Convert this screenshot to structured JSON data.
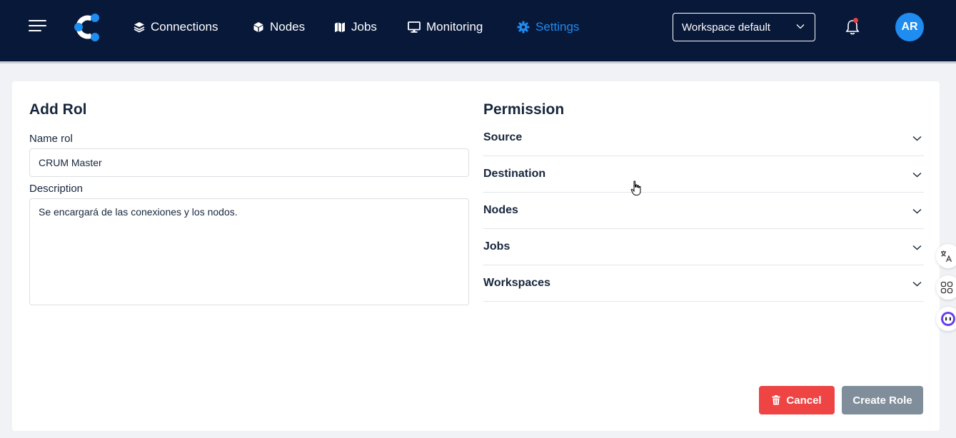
{
  "nav": {
    "items": [
      {
        "label": "Connections",
        "icon": "layers-icon"
      },
      {
        "label": "Nodes",
        "icon": "cube-icon"
      },
      {
        "label": "Jobs",
        "icon": "map-icon"
      },
      {
        "label": "Monitoring",
        "icon": "monitor-icon"
      },
      {
        "label": "Settings",
        "icon": "gear-icon",
        "active": true
      }
    ],
    "workspace": "Workspace default",
    "avatar_initials": "AR",
    "colors": {
      "background": "#081839",
      "active": "#1e8cf0",
      "badge": "#ef3e3e"
    }
  },
  "form": {
    "title": "Add Rol",
    "name_label": "Name rol",
    "name_value": "CRUM Master",
    "description_label": "Description",
    "description_value": "Se encargará de las conexiones y los nodos."
  },
  "permission": {
    "title": "Permission",
    "items": [
      "Source",
      "Destination",
      "Nodes",
      "Jobs",
      "Workspaces"
    ]
  },
  "actions": {
    "cancel_label": "Cancel",
    "create_label": "Create Role",
    "colors": {
      "cancel": "#ef4444",
      "create": "#7f8e9a"
    }
  }
}
